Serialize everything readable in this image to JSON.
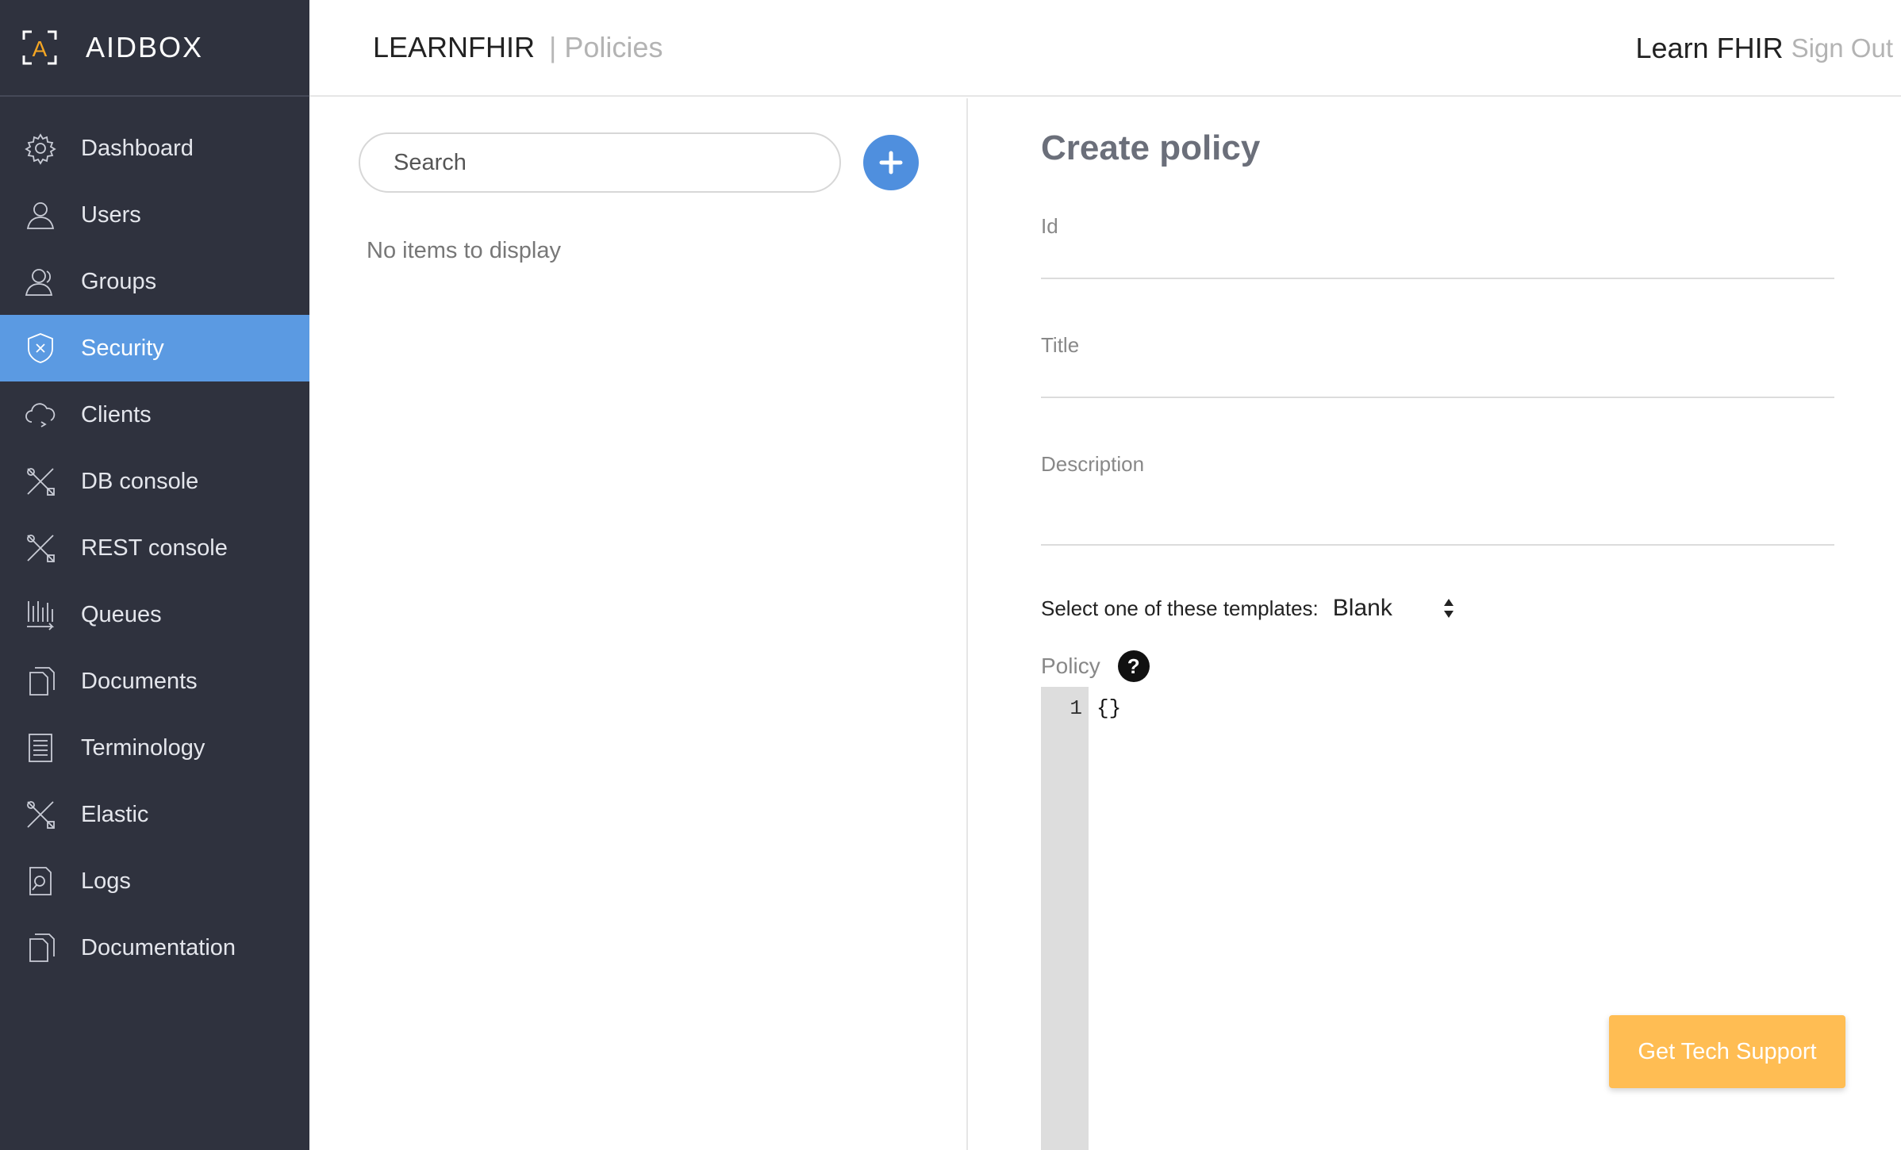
{
  "brand": {
    "name": "AIDBOX",
    "logo_letter": "A",
    "accent": "#f5a623"
  },
  "sidebar": {
    "items": [
      {
        "label": "Dashboard",
        "icon": "gear-icon"
      },
      {
        "label": "Users",
        "icon": "user-icon"
      },
      {
        "label": "Groups",
        "icon": "group-icon"
      },
      {
        "label": "Security",
        "icon": "shield-icon",
        "active": true
      },
      {
        "label": "Clients",
        "icon": "cloud-icon"
      },
      {
        "label": "DB console",
        "icon": "tools-icon"
      },
      {
        "label": "REST console",
        "icon": "tools-icon"
      },
      {
        "label": "Queues",
        "icon": "queue-icon"
      },
      {
        "label": "Documents",
        "icon": "document-icon"
      },
      {
        "label": "Terminology",
        "icon": "list-icon"
      },
      {
        "label": "Elastic",
        "icon": "tools-icon"
      },
      {
        "label": "Logs",
        "icon": "log-search-icon"
      },
      {
        "label": "Documentation",
        "icon": "document-icon"
      }
    ]
  },
  "header": {
    "title": "LEARNFHIR",
    "separator": "|",
    "section": "Policies",
    "user": "Learn FHIR",
    "signout": "Sign Out"
  },
  "list": {
    "search_placeholder": "Search",
    "empty_message": "No items to display"
  },
  "form": {
    "title": "Create policy",
    "fields": {
      "id_label": "Id",
      "title_label": "Title",
      "description_label": "Description"
    },
    "template_label": "Select one of these templates:",
    "template_value": "Blank",
    "policy_label": "Policy",
    "help_symbol": "?",
    "editor": {
      "line_number": "1",
      "code": "{}"
    }
  },
  "support": {
    "label": "Get Tech Support"
  },
  "colors": {
    "sidebar_bg": "#2f323e",
    "active_bg": "#5b9ae2",
    "add_button": "#4f8fde",
    "support_button": "#ffbd53"
  }
}
